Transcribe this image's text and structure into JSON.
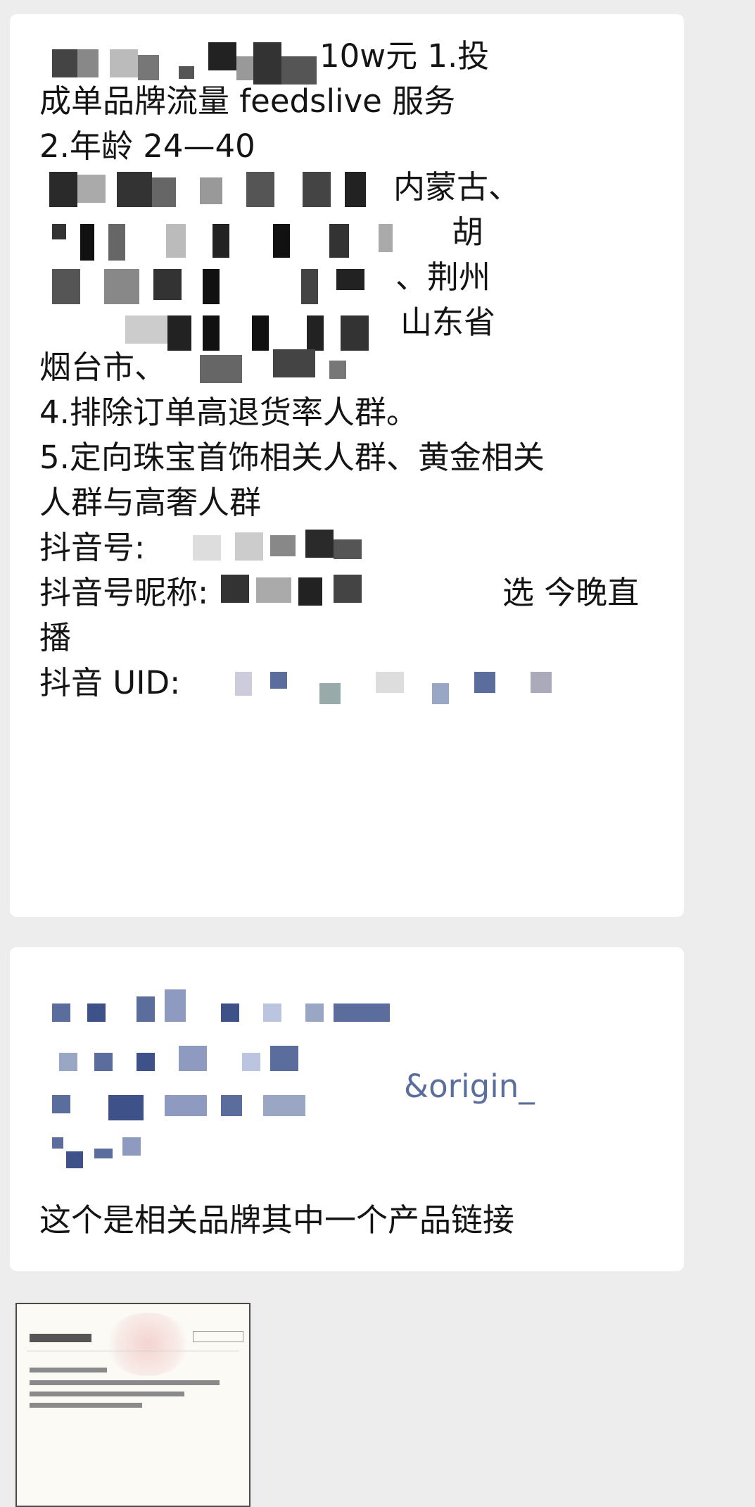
{
  "chat": {
    "message1": {
      "line1_tail": "10w元   1.投",
      "line2": "成单品牌流量  feedslive 服务",
      "line3": "2.年龄 24—40",
      "line4_tail": "内蒙古、",
      "line5_tail": "胡",
      "line6_tail": "、荆州",
      "line7_tail": "山东省",
      "line8_head": "烟台市、",
      "line9": "4.排除订单高退货率人群。",
      "line10": "5.定向珠宝首饰相关人群、黄金相关",
      "line11": "人群与高奢人群",
      "line12_label": "抖音号:",
      "line13_label": "抖音号昵称:",
      "line13_tail": "选 今晚直",
      "line14": "播",
      "line15_label": "抖音 UID:"
    },
    "message2": {
      "line3_tail": "&origin_",
      "line5": "这个是相关品牌其中一个产品链接"
    }
  },
  "colors": {
    "background": "#ededed",
    "bubble": "#ffffff",
    "text": "#141414",
    "mosaic_dark": "#3a3a3a",
    "mosaic_blue": "#5b6d9c"
  }
}
